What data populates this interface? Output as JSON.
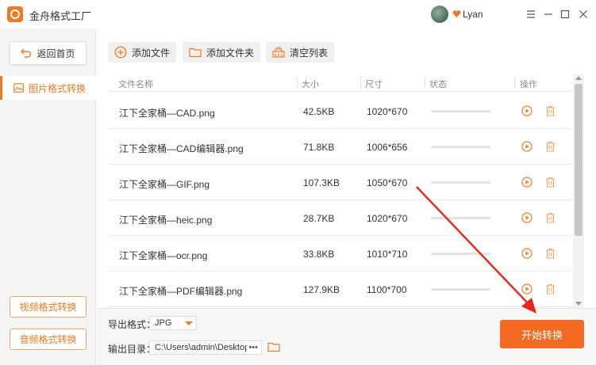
{
  "app": {
    "title": "金舟格式工厂",
    "username": "Lyan",
    "icons": [
      "app-logo-icon",
      "vip-heart-icon",
      "menu-icon",
      "minimize-icon",
      "maximize-icon",
      "close-icon"
    ]
  },
  "sidebar": {
    "home_label": "返回首页",
    "active_item": "图片格式转换",
    "video_button": "视频格式转换",
    "audio_button": "音频格式转换"
  },
  "toolbar": {
    "add_file": "添加文件",
    "add_folder": "添加文件夹",
    "clear_list": "清空列表"
  },
  "table": {
    "headers": {
      "name": "文件名称",
      "size": "大小",
      "dimensions": "尺寸",
      "status": "状态",
      "actions": "操作"
    },
    "rows": [
      {
        "name": "江下全家桶—CAD.png",
        "size": "42.5KB",
        "dimensions": "1020*670",
        "progress": 0
      },
      {
        "name": "江下全家桶—CAD编辑器.png",
        "size": "71.8KB",
        "dimensions": "1006*656",
        "progress": 0
      },
      {
        "name": "江下全家桶—GIF.png",
        "size": "107.3KB",
        "dimensions": "1050*670",
        "progress": 0
      },
      {
        "name": "江下全家桶—heic.png",
        "size": "28.7KB",
        "dimensions": "1020*670",
        "progress": 0
      },
      {
        "name": "江下全家桶—ocr.png",
        "size": "33.8KB",
        "dimensions": "1010*710",
        "progress": 0
      },
      {
        "name": "江下全家桶—PDF编辑器.png",
        "size": "127.9KB",
        "dimensions": "1100*700",
        "progress": 0
      }
    ]
  },
  "bottom": {
    "format_label": "导出格式：",
    "format_value": "JPG",
    "output_label": "输出目录：",
    "output_path": "C:\\Users\\admin\\Desktop\\",
    "more": "•••",
    "start_button": "开始转换"
  },
  "colors": {
    "accent": "#f07a22",
    "start_button": "#f46a22",
    "annotation_arrow": "#e8261c"
  }
}
